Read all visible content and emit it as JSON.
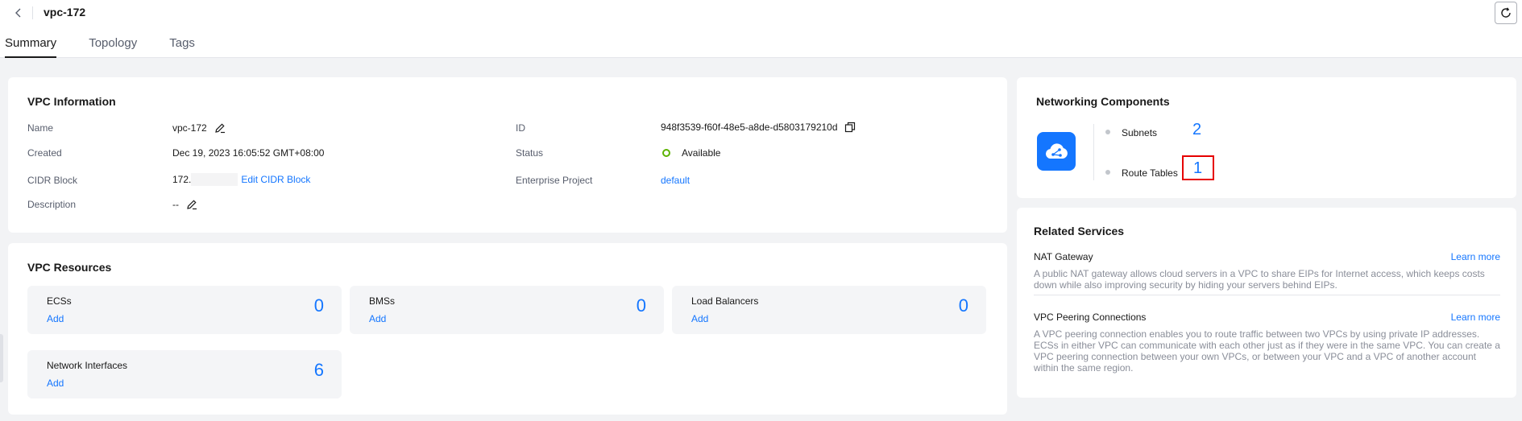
{
  "header": {
    "title": "vpc-172"
  },
  "tabs": [
    {
      "label": "Summary",
      "active": true
    },
    {
      "label": "Topology",
      "active": false
    },
    {
      "label": "Tags",
      "active": false
    }
  ],
  "vpc_info": {
    "title": "VPC Information",
    "name": {
      "label": "Name",
      "value": "vpc-172"
    },
    "created": {
      "label": "Created",
      "value": "Dec 19, 2023 16:05:52 GMT+08:00"
    },
    "cidr": {
      "label": "CIDR Block",
      "value": "172.",
      "link": "Edit CIDR Block"
    },
    "description": {
      "label": "Description",
      "value": "--"
    },
    "id": {
      "label": "ID",
      "value": "948f3539-f60f-48e5-a8de-d5803179210d"
    },
    "status": {
      "label": "Status",
      "value": "Available",
      "color": "#5cb300"
    },
    "enterprise_project": {
      "label": "Enterprise Project",
      "value": "default"
    }
  },
  "vpc_resources": {
    "title": "VPC Resources",
    "add_label": "Add",
    "items": [
      {
        "name": "ECSs",
        "count": "0"
      },
      {
        "name": "BMSs",
        "count": "0"
      },
      {
        "name": "Load Balancers",
        "count": "0"
      },
      {
        "name": "Network Interfaces",
        "count": "6"
      }
    ]
  },
  "networking": {
    "title": "Networking Components",
    "icon": "cloud-network-icon",
    "items": [
      {
        "label": "Subnets",
        "count": "2"
      },
      {
        "label": "Route Tables",
        "count": "1"
      }
    ]
  },
  "related_services": {
    "title": "Related Services",
    "learn_more": "Learn more",
    "items": [
      {
        "name": "NAT Gateway",
        "desc": "A public NAT gateway allows cloud servers in a VPC to share EIPs for Internet access, which keeps costs down while also improving security by hiding your servers behind EIPs."
      },
      {
        "name": "VPC Peering Connections",
        "desc": "A VPC peering connection enables you to route traffic between two VPCs by using private IP addresses. ECSs in either VPC can communicate with each other just as if they were in the same VPC. You can create a VPC peering connection between your own VPCs, or between your VPC and a VPC of another account within the same region."
      }
    ]
  },
  "colors": {
    "accent": "#1476ff",
    "highlight": "#e60000"
  }
}
